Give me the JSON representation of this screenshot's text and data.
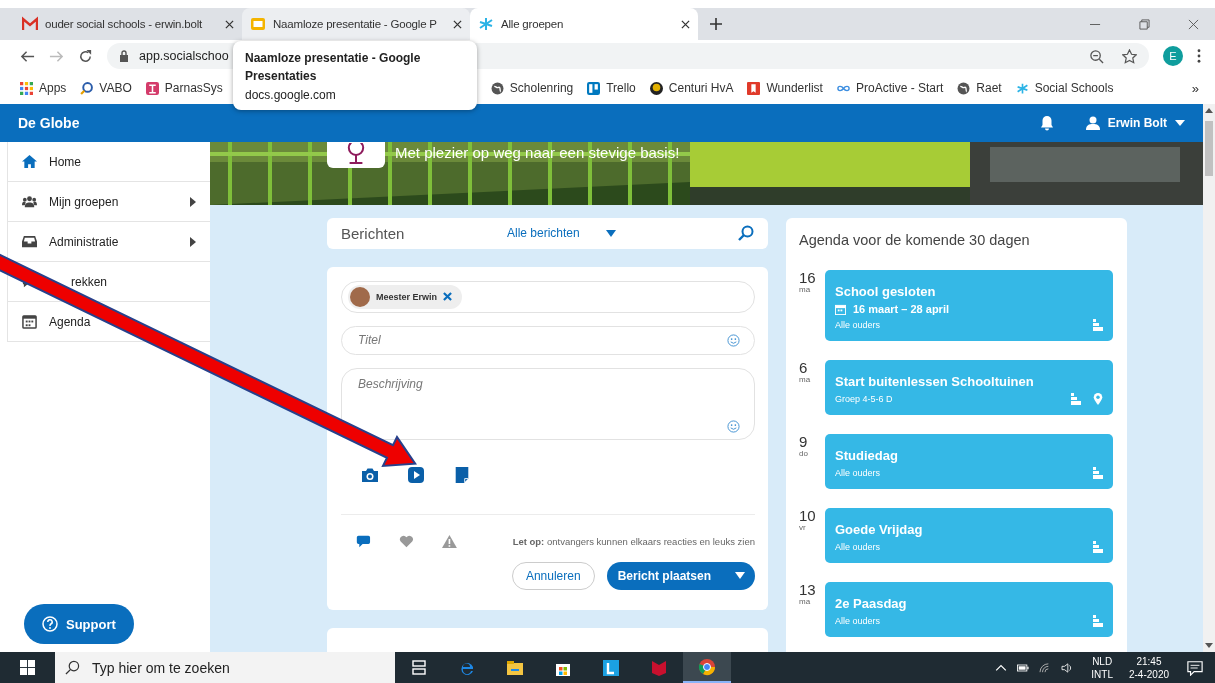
{
  "browser": {
    "tabs": [
      {
        "title": "ouder social schools - erwin.bolt",
        "selected": false,
        "hovered": false
      },
      {
        "title": "Naamloze presentatie - Google P",
        "selected": false,
        "hovered": true
      },
      {
        "title": "Alle groepen",
        "selected": true,
        "hovered": false
      }
    ],
    "address": "app.socialschoo",
    "profile": "E",
    "bookmarks_left": [
      {
        "label": "Apps"
      },
      {
        "label": "VABO"
      },
      {
        "label": "ParnasSys"
      }
    ],
    "bookmarks_right": [
      {
        "label": "Scholenring"
      },
      {
        "label": "Trello"
      },
      {
        "label": "Centuri HvA"
      },
      {
        "label": "Wunderlist"
      },
      {
        "label": "ProActive - Start"
      },
      {
        "label": "Raet"
      },
      {
        "label": "Social Schools"
      }
    ],
    "more": "»",
    "tooltip": {
      "title": "Naamloze presentatie - Google Presentaties",
      "url": "docs.google.com"
    }
  },
  "app": {
    "title": "De Globe",
    "user": "Erwin Bolt",
    "sidebar": [
      {
        "label": "Home",
        "submenu": false
      },
      {
        "label": "Mijn groepen",
        "submenu": true
      },
      {
        "label": "Administratie",
        "submenu": true
      },
      {
        "label": "rekken",
        "submenu": false
      },
      {
        "label": "Agenda",
        "submenu": false
      }
    ],
    "tagline": "Met plezier op weg naar een stevige basis!",
    "feed": {
      "title": "Berichten",
      "filter": "Alle berichten"
    },
    "composer": {
      "recipient": "Meester Erwin",
      "title_placeholder": "Titel",
      "description_placeholder": "Beschrijving",
      "reactions": [
        {
          "on": true
        },
        {
          "on": false
        },
        {
          "on": false
        }
      ],
      "note": "**Let op:** ontvangers kunnen elkaars reacties en leuks zien",
      "cancel": "Annuleren",
      "submit": "Bericht plaatsen"
    },
    "agenda": {
      "title": "Agenda voor de komende 30 dagen",
      "events": [
        {
          "day": "16",
          "weekday": "ma",
          "title": "School gesloten",
          "period": "16 maart – 28 april",
          "audience": "Alle ouders",
          "location": false
        },
        {
          "day": "6",
          "weekday": "ma",
          "title": "Start buitenlessen Schooltuinen",
          "audience": "Groep 4-5-6 D",
          "location": true
        },
        {
          "day": "9",
          "weekday": "do",
          "title": "Studiedag",
          "audience": "Alle ouders",
          "location": false
        },
        {
          "day": "10",
          "weekday": "vr",
          "title": "Goede Vrijdag",
          "audience": "Alle ouders",
          "location": false
        },
        {
          "day": "13",
          "weekday": "ma",
          "title": "2e Paasdag",
          "audience": "Alle ouders",
          "location": false
        }
      ]
    },
    "support": "Support"
  },
  "taskbar": {
    "search_placeholder": "Typ hier om te zoeken",
    "apps": [
      {
        "active": false
      },
      {
        "active": false
      },
      {
        "active": false
      },
      {
        "active": false
      },
      {
        "active": false
      },
      {
        "active": false
      },
      {
        "active": true
      }
    ],
    "language": "NLD",
    "layout": "INTL",
    "time": "21:45",
    "date": "2-4-2020"
  }
}
